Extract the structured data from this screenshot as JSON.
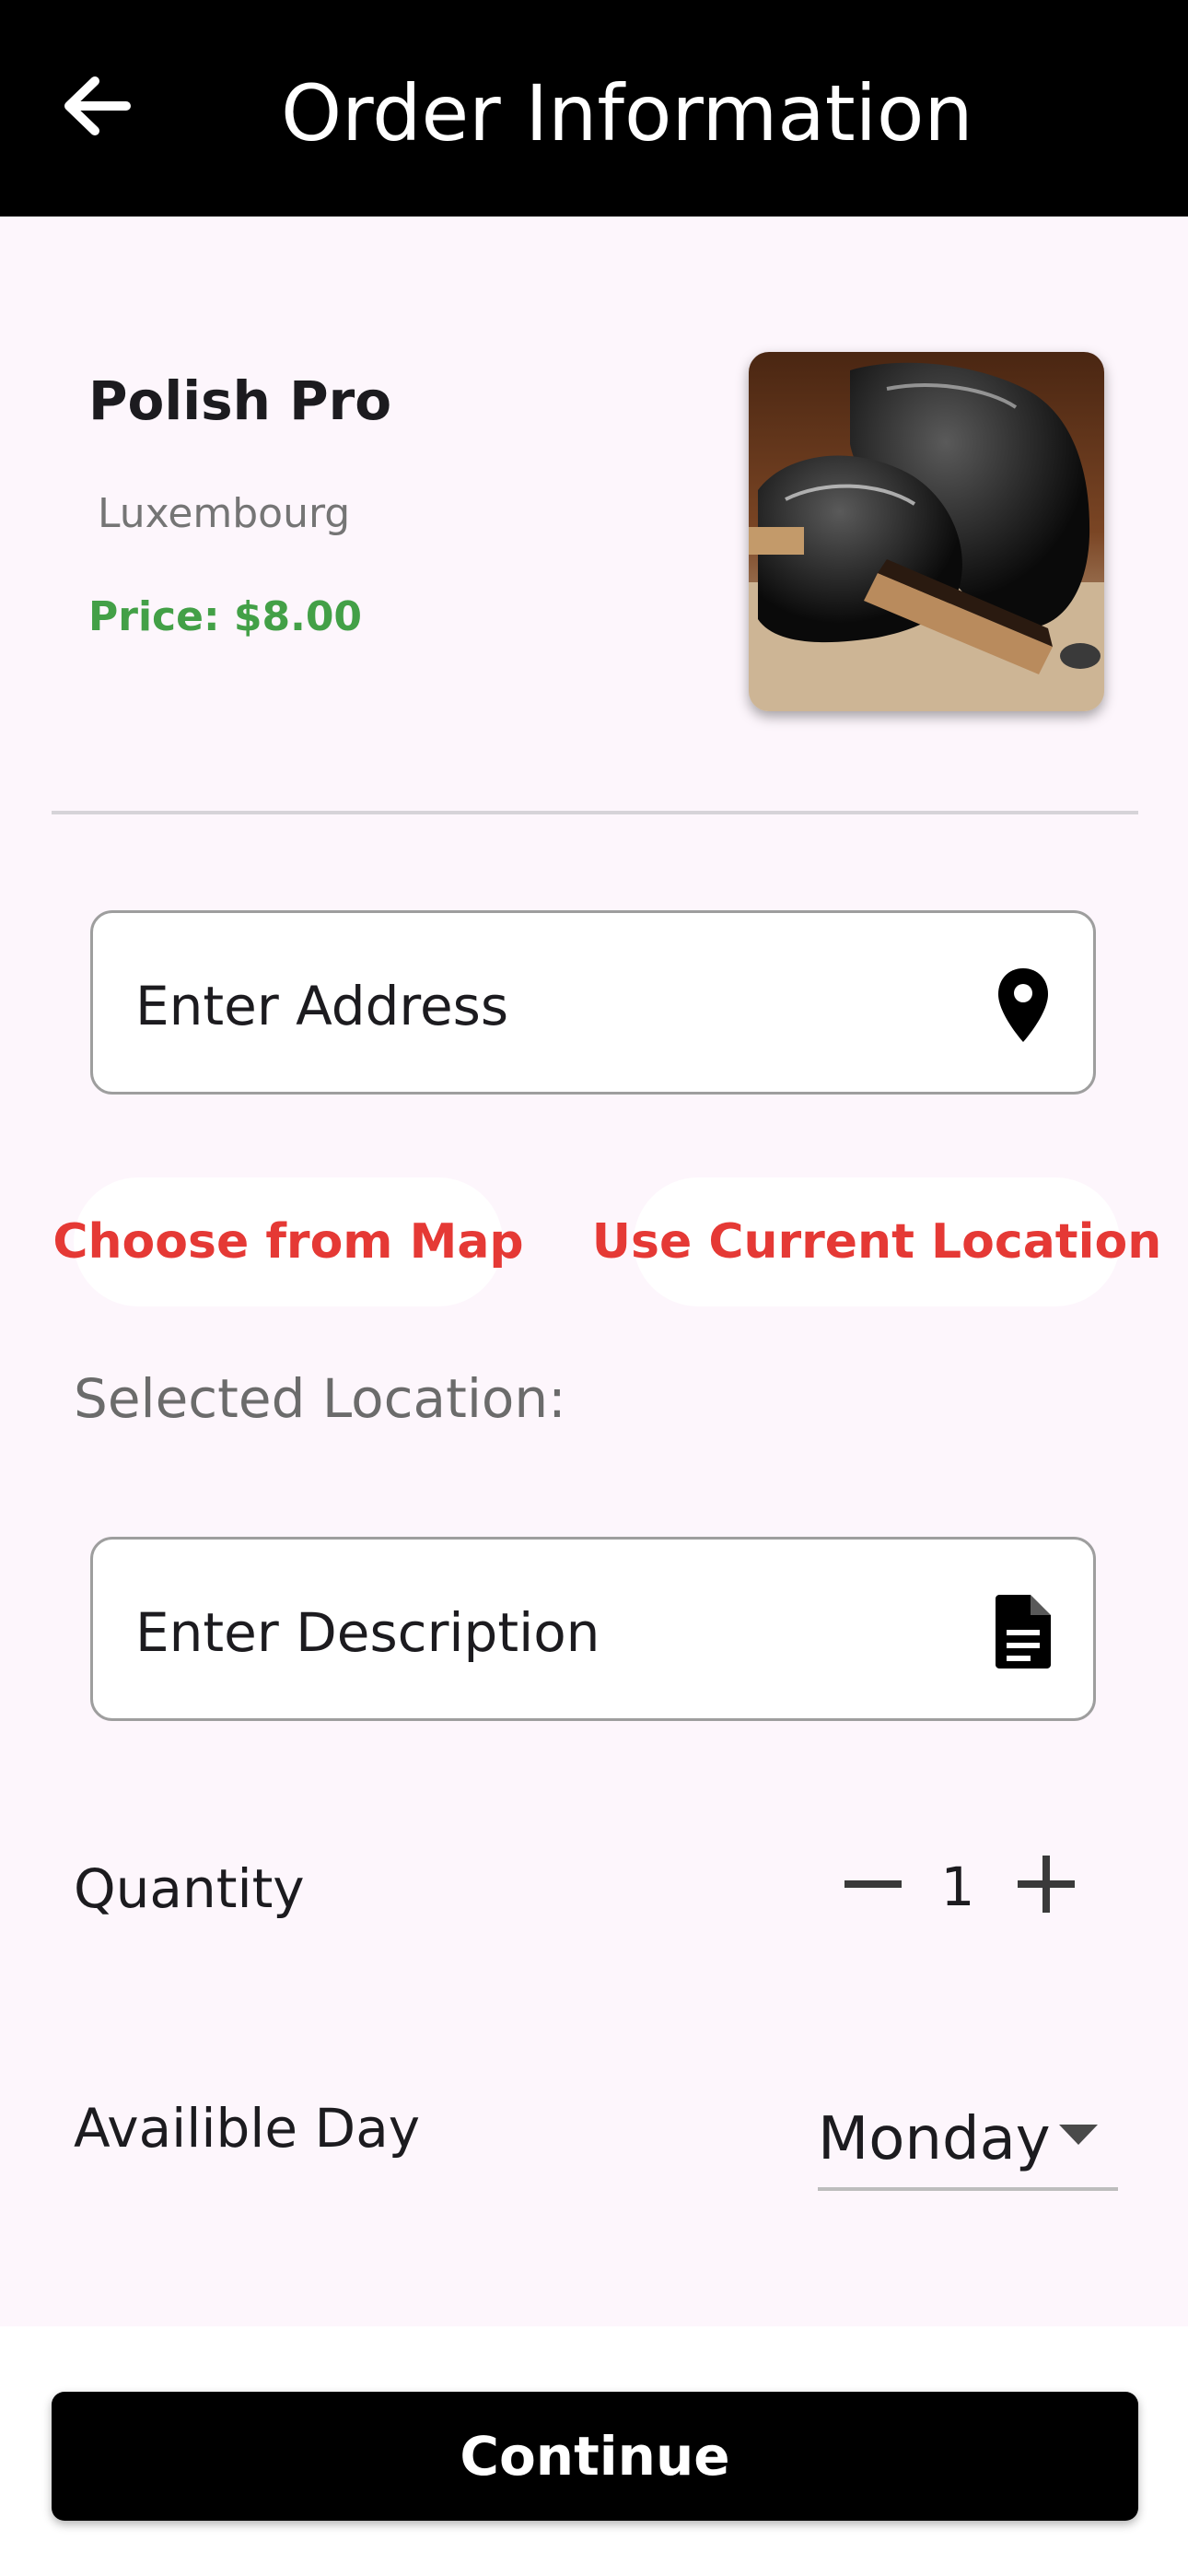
{
  "header": {
    "title": "Order Information",
    "back_icon": "arrow-left-icon"
  },
  "service": {
    "name": "Polish Pro",
    "location": "Luxembourg",
    "price_text": "Price: $8.00",
    "image_alt": "Polished black leather shoes with a shoe brush",
    "image_icon": "shoe-photo"
  },
  "address_field": {
    "placeholder": "Enter Address",
    "icon": "location-pin-icon"
  },
  "location_actions": {
    "choose_map_label": "Choose from Map",
    "current_location_label": "Use Current Location"
  },
  "selected_location": {
    "label": "Selected Location:"
  },
  "description_field": {
    "placeholder": "Enter Description",
    "icon": "document-icon"
  },
  "quantity": {
    "label": "Quantity",
    "value": "1",
    "decrement_icon": "minus-icon",
    "increment_icon": "plus-icon"
  },
  "available_day": {
    "label": "Availible Day",
    "selected": "Monday",
    "icon": "caret-down-icon"
  },
  "footer": {
    "continue_label": "Continue"
  },
  "colors": {
    "app_bar": "#000000",
    "background": "#fdf6fc",
    "price_green": "#43a047",
    "action_red": "#e53935",
    "button": "#000000"
  }
}
